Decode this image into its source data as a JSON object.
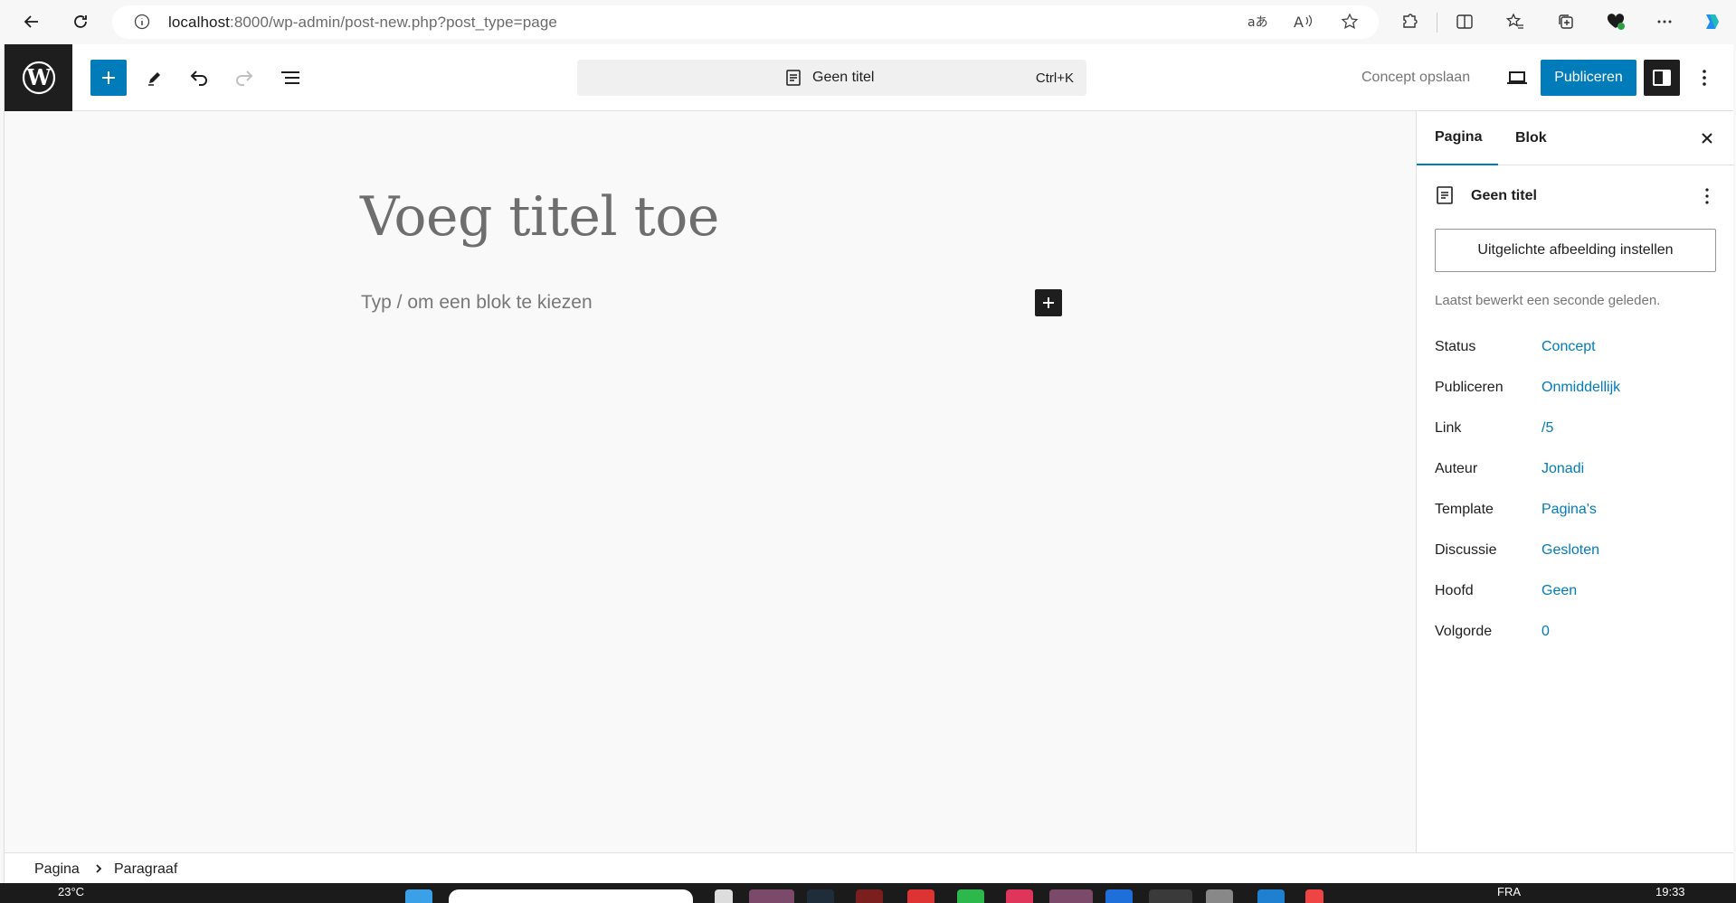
{
  "browser": {
    "url_host": "localhost",
    "url_path": ":8000/wp-admin/post-new.php?post_type=page"
  },
  "toolbar": {
    "doc_title": "Geen titel",
    "shortcut": "Ctrl+K",
    "save_draft": "Concept opslaan",
    "publish": "Publiceren"
  },
  "canvas": {
    "title_placeholder": "Voeg titel toe",
    "block_placeholder": "Typ / om een blok te kiezen"
  },
  "sidebar": {
    "tabs": [
      {
        "label": "Pagina",
        "active": true
      },
      {
        "label": "Blok",
        "active": false
      }
    ],
    "post_title": "Geen titel",
    "featured_image": "Uitgelichte afbeelding instellen",
    "last_edited": "Laatst bewerkt een seconde geleden.",
    "meta": [
      {
        "key": "Status",
        "value": "Concept"
      },
      {
        "key": "Publiceren",
        "value": "Onmiddellijk"
      },
      {
        "key": "Link",
        "value": "/5"
      },
      {
        "key": "Auteur",
        "value": "Jonadi"
      },
      {
        "key": "Template",
        "value": "Pagina's"
      },
      {
        "key": "Discussie",
        "value": "Gesloten"
      },
      {
        "key": "Hoofd",
        "value": "Geen"
      },
      {
        "key": "Volgorde",
        "value": "0"
      }
    ]
  },
  "breadcrumb": [
    "Pagina",
    "Paragraaf"
  ],
  "taskbar": {
    "temperature": "23°C",
    "language": "FRA",
    "time": "19:33"
  },
  "colors": {
    "accent": "#007cba",
    "dark": "#1e1e1e"
  }
}
